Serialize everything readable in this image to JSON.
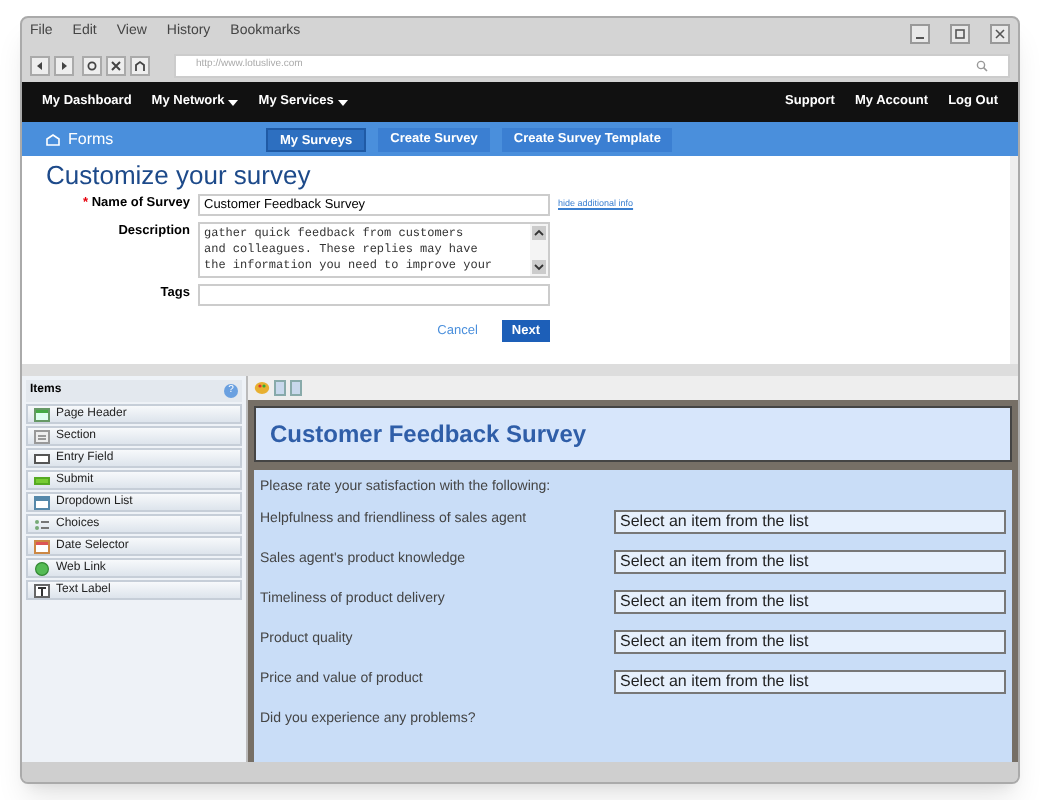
{
  "browser": {
    "menu": [
      "File",
      "Edit",
      "View",
      "History",
      "Bookmarks"
    ],
    "url": "http://www.lotuslive.com"
  },
  "top_nav": {
    "left": [
      {
        "label": "My Dashboard",
        "dropdown": false
      },
      {
        "label": "My Network",
        "dropdown": true
      },
      {
        "label": "My Services",
        "dropdown": true
      }
    ],
    "right": [
      "Support",
      "My Account",
      "Log Out"
    ]
  },
  "section_bar": {
    "title": "Forms",
    "tabs": [
      {
        "label": "My Surveys",
        "selected": true
      },
      {
        "label": "Create Survey",
        "selected": false
      },
      {
        "label": "Create Survey Template",
        "selected": false
      }
    ]
  },
  "form": {
    "heading": "Customize your survey",
    "required_mark": "*",
    "name_label": "Name of Survey",
    "name_value": "Customer Feedback Survey",
    "info_link": "hide additional info",
    "description_label": "Description",
    "description_lines": [
      "gather quick feedback from customers",
      "and colleagues. These replies may have",
      "the information you need to improve your"
    ],
    "tags_label": "Tags",
    "cancel": "Cancel",
    "next": "Next"
  },
  "items_panel": {
    "title": "Items",
    "help": "?",
    "items": [
      {
        "label": "Page Header",
        "kind": "header"
      },
      {
        "label": "Section",
        "kind": "section"
      },
      {
        "label": "Entry Field",
        "kind": "field"
      },
      {
        "label": "Submit",
        "kind": "submit"
      },
      {
        "label": "Dropdown List",
        "kind": "dropdown"
      },
      {
        "label": "Choices",
        "kind": "choices"
      },
      {
        "label": "Date Selector",
        "kind": "date"
      },
      {
        "label": "Web Link",
        "kind": "link"
      },
      {
        "label": "Text Label",
        "kind": "text"
      }
    ]
  },
  "preview": {
    "title": "Customer Feedback Survey",
    "intro": "Please rate your satisfaction with the following:",
    "questions": [
      {
        "label": "Helpfulness and friendliness of sales agent",
        "placeholder": "Select an item from the list"
      },
      {
        "label": "Sales agent's product knowledge",
        "placeholder": "Select an item from the list"
      },
      {
        "label": "Timeliness of product delivery",
        "placeholder": "Select an item from the list"
      },
      {
        "label": "Product quality",
        "placeholder": "Select an item from the list"
      },
      {
        "label": "Price and value of product",
        "placeholder": "Select an item from the list"
      }
    ],
    "cut_text": "Did you experience any problems?"
  }
}
